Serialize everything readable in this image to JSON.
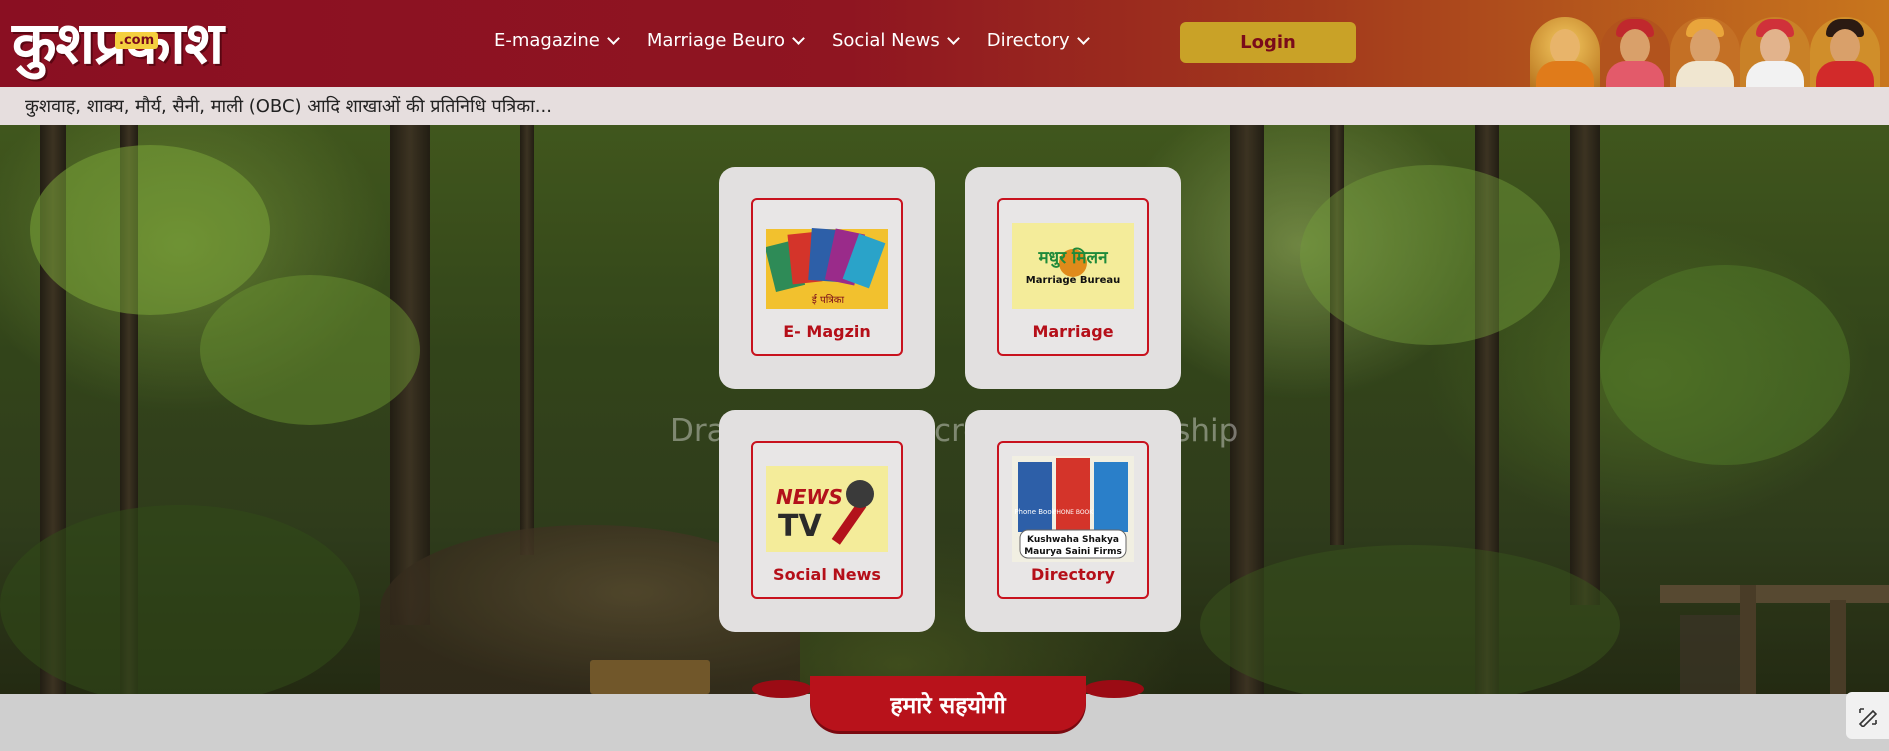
{
  "header": {
    "logo_text": "कुशप्रकाश",
    "logo_badge": ".com",
    "nav": [
      {
        "label": "E-magazine"
      },
      {
        "label": "Marriage Beuro"
      },
      {
        "label": "Social News"
      },
      {
        "label": "Directory"
      }
    ],
    "login_label": "Login"
  },
  "tagline": "कुशवाह, शाक्य, मौर्य, सैनी, माली (OBC) आदि शाखाओं की प्रतिनिधि पत्रिका...",
  "hero": {
    "watermark": "Draw a shape to create a screenship"
  },
  "cards": [
    {
      "label": "E- Magzin",
      "img_caption": "ई पत्रिका"
    },
    {
      "label": "Marriage",
      "img_title": "मधुर मिलन",
      "img_subtitle": "Marriage Bureau"
    },
    {
      "label": "Social News",
      "img_title": "NEWS",
      "img_subtitle": "TV"
    },
    {
      "label": "Directory",
      "img_line1": "Kushwaha Shakya",
      "img_line2": "Maurya Saini Firms",
      "book1": "Phone Book",
      "book2": "PHONE BOOK"
    }
  ],
  "footer": {
    "ribbon_label": "हमारे सहयोगी"
  },
  "colors": {
    "brand_red": "#8a0f22",
    "accent_gold": "#c9a227",
    "card_red": "#b50f19"
  }
}
